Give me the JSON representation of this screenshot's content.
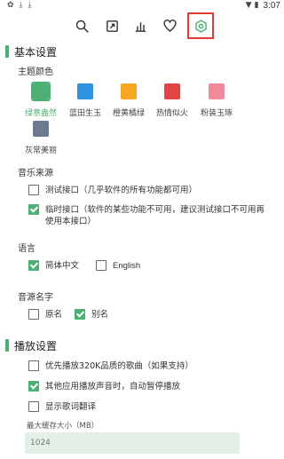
{
  "status_bar": {
    "time": "3:07"
  },
  "toolbar": {
    "items": [
      {
        "name": "search"
      },
      {
        "name": "share"
      },
      {
        "name": "leaderboard"
      },
      {
        "name": "favorites"
      },
      {
        "name": "settings",
        "active": true
      }
    ],
    "active_highlight_color": "#e53935"
  },
  "basic_settings": {
    "title": "基本设置",
    "theme_color_label": "主题颜色",
    "themes": [
      {
        "name": "绿意盎然",
        "color": "#4caf73",
        "selected": true
      },
      {
        "name": "蓝田生玉",
        "color": "#2f93e0",
        "selected": false
      },
      {
        "name": "橙黄橘绿",
        "color": "#f5a623",
        "selected": false
      },
      {
        "name": "热情似火",
        "color": "#e04444",
        "selected": false
      },
      {
        "name": "粉装玉琢",
        "color": "#f08a9b",
        "selected": false
      },
      {
        "name": "灰常美丽",
        "color": "#6b7a8f",
        "selected": false
      }
    ],
    "music_source_label": "音乐来源",
    "music_sources": [
      {
        "text": "测试接口（几乎软件的所有功能都可用）",
        "checked": false
      },
      {
        "text": "临时接口（软件的某些功能不可用，建议测试接口不可用再使用本接口）",
        "checked": true
      }
    ],
    "language_label": "语言",
    "languages": [
      {
        "text": "简体中文",
        "checked": true
      },
      {
        "text": "English",
        "checked": false
      }
    ],
    "source_name_label": "音源名字",
    "source_names": [
      {
        "text": "原名",
        "checked": false
      },
      {
        "text": "别名",
        "checked": true
      }
    ]
  },
  "playback_settings": {
    "title": "播放设置",
    "options": [
      {
        "text": "优先播放320K品质的歌曲（如果支持）",
        "checked": false
      },
      {
        "text": "其他应用播放声音时，自动暂停播放",
        "checked": true
      },
      {
        "text": "显示歌词翻译",
        "checked": false
      }
    ],
    "cache_label": "最大缓存大小（MB）",
    "cache_placeholder": "1024"
  }
}
